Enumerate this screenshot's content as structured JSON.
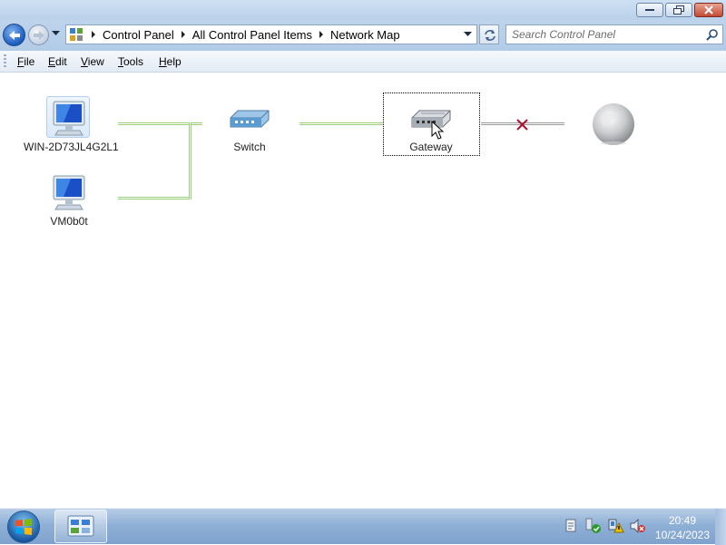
{
  "window": {
    "minimize_icon": "minimize-icon",
    "maximize_icon": "restore-icon",
    "close_icon": "close-icon"
  },
  "nav": {
    "back_icon": "back-arrow-icon",
    "forward_icon": "forward-arrow-icon",
    "breadcrumbs": [
      "Control Panel",
      "All Control Panel Items",
      "Network Map"
    ],
    "search_placeholder": "Search Control Panel"
  },
  "menu": {
    "items": [
      {
        "label": "File",
        "accel": "F",
        "rest": "ile"
      },
      {
        "label": "Edit",
        "accel": "E",
        "rest": "dit"
      },
      {
        "label": "View",
        "accel": "V",
        "rest": "iew"
      },
      {
        "label": "Tools",
        "accel": "T",
        "rest": "ools"
      },
      {
        "label": "Help",
        "accel": "H",
        "rest": "elp"
      }
    ]
  },
  "map": {
    "computers": [
      {
        "label": "WIN-2D73JL4G2L1",
        "icon": "computer-icon"
      },
      {
        "label": "VM0b0t",
        "icon": "computer-icon"
      }
    ],
    "switch": {
      "label": "Switch",
      "icon": "switch-icon"
    },
    "gateway": {
      "label": "Gateway",
      "icon": "gateway-icon"
    },
    "internet": {
      "label": "",
      "icon": "globe-icon"
    },
    "broken_link_icon": "x-icon"
  },
  "taskbar": {
    "time": "20:49",
    "date": "10/24/2023",
    "colors": {
      "accent": "#1b5cbf",
      "link_line": "#9ccf7c",
      "broken": "#b0102a"
    }
  }
}
